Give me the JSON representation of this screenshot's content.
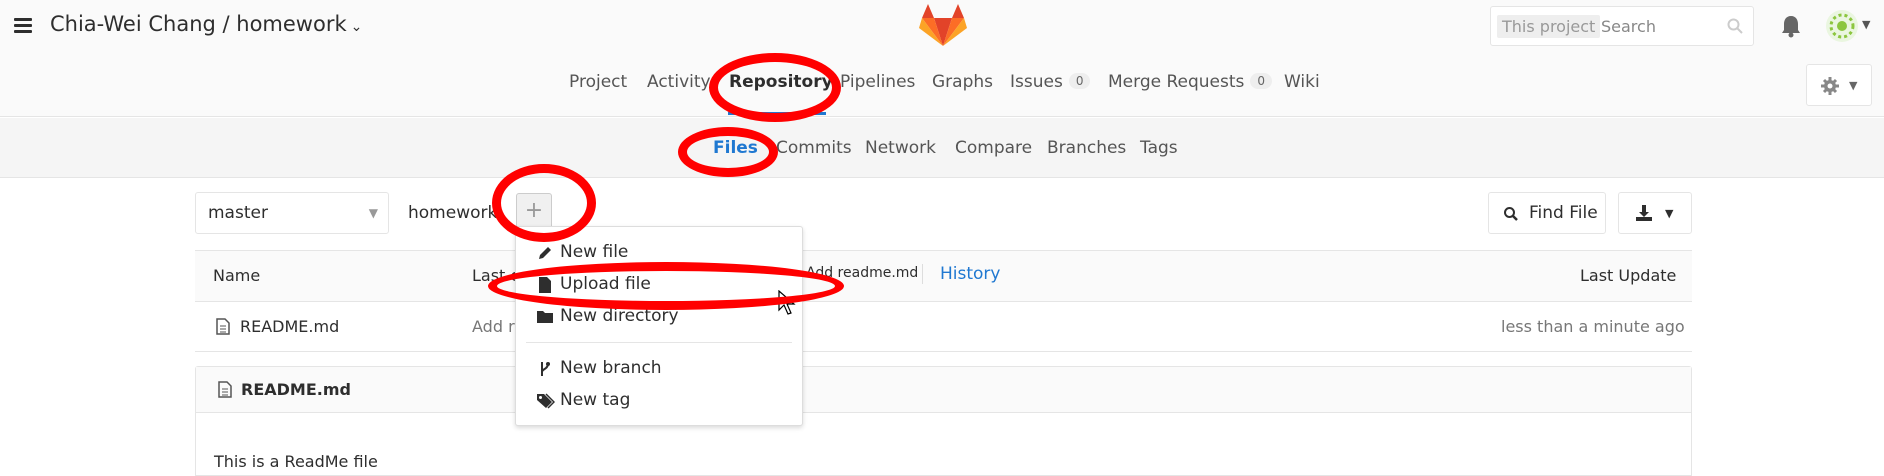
{
  "header": {
    "project_path": "Chia-Wei Chang / homework",
    "search_scope": "This project",
    "search_placeholder": "Search"
  },
  "nav": {
    "items": [
      {
        "label": "Project"
      },
      {
        "label": "Activity"
      },
      {
        "label": "Repository"
      },
      {
        "label": "Pipelines"
      },
      {
        "label": "Graphs"
      },
      {
        "label": "Issues",
        "count": "0"
      },
      {
        "label": "Merge Requests",
        "count": "0"
      },
      {
        "label": "Wiki"
      }
    ],
    "active": "Repository"
  },
  "subnav": {
    "items": [
      {
        "label": "Files"
      },
      {
        "label": "Commits"
      },
      {
        "label": "Network"
      },
      {
        "label": "Compare"
      },
      {
        "label": "Branches"
      },
      {
        "label": "Tags"
      }
    ],
    "active": "Files"
  },
  "toolbar": {
    "branch": "master",
    "breadcrumb": "homework",
    "add_button": "+",
    "find_file": "Find File"
  },
  "dropdown": {
    "items": [
      {
        "label": "New file",
        "icon": "pencil-icon"
      },
      {
        "label": "Upload file",
        "icon": "file-icon"
      },
      {
        "label": "New directory",
        "icon": "folder-icon"
      },
      {
        "label": "New branch",
        "icon": "branch-icon"
      },
      {
        "label": "New tag",
        "icon": "tag-icon"
      }
    ]
  },
  "table": {
    "headers": {
      "name": "Name",
      "last_commit": "Last c",
      "last_update": "Last Update"
    },
    "commit_message": "Add readme.md",
    "history": "History",
    "rows": [
      {
        "name": "README.md",
        "commit": "Add r",
        "updated": "less than a minute ago"
      }
    ]
  },
  "readme": {
    "title": "README.md",
    "body": "This is a ReadMe file"
  },
  "colors": {
    "annotation": "#ff0000",
    "link": "#1f78d1",
    "logo_orange": "#fc6d26",
    "logo_red": "#e24329",
    "logo_light": "#fca326"
  }
}
